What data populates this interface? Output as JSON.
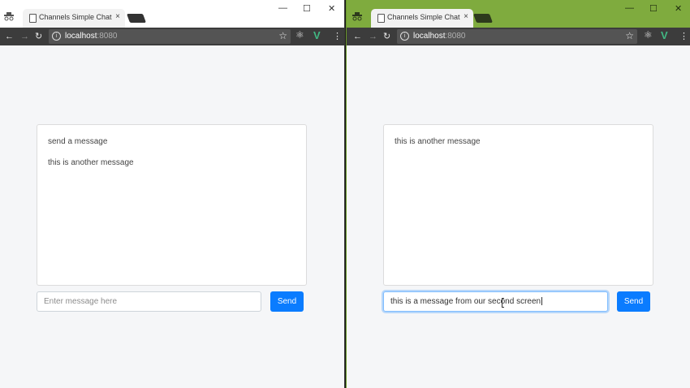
{
  "left_window": {
    "tab_title": "Channels Simple Chat",
    "tab_close": "×",
    "address": {
      "host": "localhost",
      "port": ":8080"
    },
    "messages": [
      "send a message",
      "this is another message"
    ],
    "input": {
      "value": "",
      "placeholder": "Enter message here"
    },
    "send_label": "Send",
    "titlebar_color": "#ffffff"
  },
  "right_window": {
    "tab_title": "Channels Simple Chat",
    "tab_close": "×",
    "address": {
      "host": "localhost",
      "port": ":8080"
    },
    "messages": [
      "this is another message"
    ],
    "input": {
      "value": "this is a message from our second screen",
      "placeholder": ""
    },
    "send_label": "Send",
    "titlebar_color": "#7fab3e"
  },
  "icons": {
    "minimize": "—",
    "maximize": "☐",
    "close": "✕",
    "back": "←",
    "forward": "→",
    "reload": "↻",
    "star": "☆",
    "menu": "⋮",
    "vue": "V",
    "react": "⚛"
  },
  "colors": {
    "accent": "#0a7cff",
    "vue": "#41b883"
  }
}
